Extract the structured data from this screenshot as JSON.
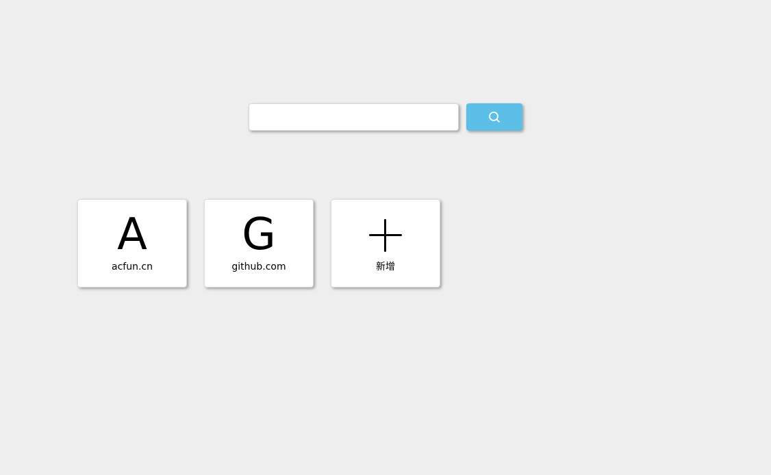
{
  "search": {
    "value": "",
    "placeholder": "",
    "button_icon": "search-icon"
  },
  "colors": {
    "background": "#eeeeee",
    "accent": "#5bbfe8",
    "card": "#ffffff"
  },
  "sites": [
    {
      "logo": "A",
      "label": "acfun.cn"
    },
    {
      "logo": "G",
      "label": "github.com"
    }
  ],
  "add_card": {
    "icon": "plus-icon",
    "label": "新增"
  }
}
